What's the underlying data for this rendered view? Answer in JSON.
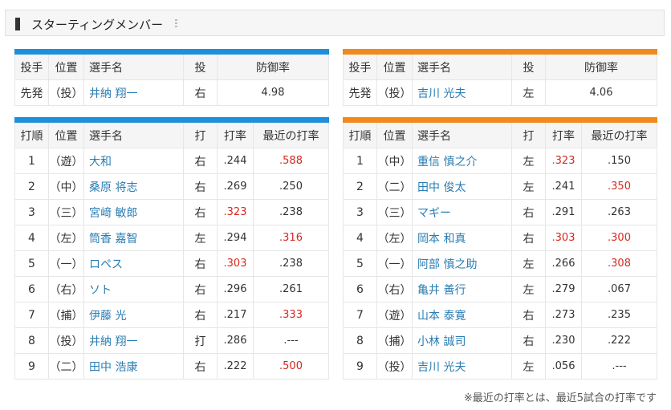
{
  "header": {
    "title": "スターティングメンバー"
  },
  "pitching_headers": [
    "投手",
    "位置",
    "選手名",
    "投",
    "防御率"
  ],
  "batting_headers": [
    "打順",
    "位置",
    "選手名",
    "打",
    "打率",
    "最近の打率"
  ],
  "left": {
    "pitcher": {
      "role": "先発",
      "pos": "（投）",
      "name": "井納 翔一",
      "hand": "右",
      "era": "4.98"
    },
    "lineup": [
      {
        "order": "1",
        "pos": "（遊）",
        "name": "大和",
        "hand": "右",
        "avg": ".244",
        "recent": ".588",
        "avg_red": false,
        "recent_red": true
      },
      {
        "order": "2",
        "pos": "（中）",
        "name": "桑原 将志",
        "hand": "右",
        "avg": ".269",
        "recent": ".250",
        "avg_red": false,
        "recent_red": false
      },
      {
        "order": "3",
        "pos": "（三）",
        "name": "宮﨑 敏郎",
        "hand": "右",
        "avg": ".323",
        "recent": ".238",
        "avg_red": true,
        "recent_red": false
      },
      {
        "order": "4",
        "pos": "（左）",
        "name": "筒香 嘉智",
        "hand": "左",
        "avg": ".294",
        "recent": ".316",
        "avg_red": false,
        "recent_red": true
      },
      {
        "order": "5",
        "pos": "（一）",
        "name": "ロペス",
        "hand": "右",
        "avg": ".303",
        "recent": ".238",
        "avg_red": true,
        "recent_red": false
      },
      {
        "order": "6",
        "pos": "（右）",
        "name": "ソト",
        "hand": "右",
        "avg": ".296",
        "recent": ".261",
        "avg_red": false,
        "recent_red": false
      },
      {
        "order": "7",
        "pos": "（捕）",
        "name": "伊藤 光",
        "hand": "右",
        "avg": ".217",
        "recent": ".333",
        "avg_red": false,
        "recent_red": true
      },
      {
        "order": "8",
        "pos": "（投）",
        "name": "井納 翔一",
        "hand": "打",
        "avg": ".286",
        "recent": ".---",
        "avg_red": false,
        "recent_red": false
      },
      {
        "order": "9",
        "pos": "（二）",
        "name": "田中 浩康",
        "hand": "右",
        "avg": ".222",
        "recent": ".500",
        "avg_red": false,
        "recent_red": true
      }
    ]
  },
  "right": {
    "pitcher": {
      "role": "先発",
      "pos": "（投）",
      "name": "吉川 光夫",
      "hand": "左",
      "era": "4.06"
    },
    "lineup": [
      {
        "order": "1",
        "pos": "（中）",
        "name": "重信 慎之介",
        "hand": "左",
        "avg": ".323",
        "recent": ".150",
        "avg_red": true,
        "recent_red": false
      },
      {
        "order": "2",
        "pos": "（二）",
        "name": "田中 俊太",
        "hand": "左",
        "avg": ".241",
        "recent": ".350",
        "avg_red": false,
        "recent_red": true
      },
      {
        "order": "3",
        "pos": "（三）",
        "name": "マギー",
        "hand": "右",
        "avg": ".291",
        "recent": ".263",
        "avg_red": false,
        "recent_red": false
      },
      {
        "order": "4",
        "pos": "（左）",
        "name": "岡本 和真",
        "hand": "右",
        "avg": ".303",
        "recent": ".300",
        "avg_red": true,
        "recent_red": true
      },
      {
        "order": "5",
        "pos": "（一）",
        "name": "阿部 慎之助",
        "hand": "左",
        "avg": ".266",
        "recent": ".308",
        "avg_red": false,
        "recent_red": true
      },
      {
        "order": "6",
        "pos": "（右）",
        "name": "亀井 善行",
        "hand": "左",
        "avg": ".279",
        "recent": ".067",
        "avg_red": false,
        "recent_red": false
      },
      {
        "order": "7",
        "pos": "（遊）",
        "name": "山本 泰寛",
        "hand": "右",
        "avg": ".273",
        "recent": ".235",
        "avg_red": false,
        "recent_red": false
      },
      {
        "order": "8",
        "pos": "（捕）",
        "name": "小林 誠司",
        "hand": "右",
        "avg": ".230",
        "recent": ".222",
        "avg_red": false,
        "recent_red": false
      },
      {
        "order": "9",
        "pos": "（投）",
        "name": "吉川 光夫",
        "hand": "左",
        "avg": ".056",
        "recent": ".---",
        "avg_red": false,
        "recent_red": false
      }
    ]
  },
  "note": "※最近の打率とは、最近5試合の打率です",
  "colors": {
    "left_accent": "#1e90d9",
    "right_accent": "#f08a1c",
    "highlight": "#d6281f",
    "name_link": "#2a7db3"
  }
}
